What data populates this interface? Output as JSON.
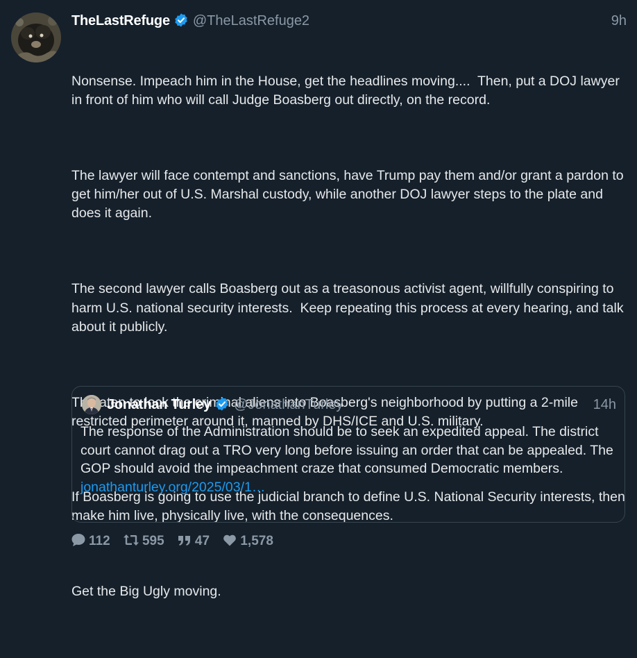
{
  "tweet": {
    "author": {
      "display_name": "TheLastRefuge",
      "handle": "@TheLastRefuge2",
      "verified_icon": "verified-badge-icon",
      "avatar_icon": "avatar-image"
    },
    "time": "9h",
    "paragraphs": [
      "Nonsense. Impeach him in the House, get the headlines moving....  Then, put a DOJ lawyer in front of him who will call Judge Boasberg out directly, on the record.",
      "The lawyer will face contempt and sanctions, have Trump pay them and/or grant a pardon to get him/her out of U.S. Marshal custody, while another DOJ lawyer steps to the plate and does it again.",
      "The second lawyer calls Boasberg out as a treasonous activist agent, willfully conspiring to harm U.S. national security interests.  Keep repeating this process at every hearing, and talk about it publicly.",
      "Threaten to lock the criminal aliens into Boasberg's neighborhood by putting a 2-mile restricted perimeter around it, manned by DHS/ICE and U.S. military.",
      "If Boasberg is going to use the judicial branch to define U.S. National Security interests, then make him live, physically live, with the consequences.",
      "Get the Big Ugly moving."
    ],
    "quote": {
      "display_name": "Jonathan Turley",
      "handle": "@JonathanTurley",
      "time": "14h",
      "text": "The response of the Administration should be to seek an expedited appeal. The district court cannot drag out a TRO very long before issuing an order that can be appealed. The GOP should avoid the impeachment craze that consumed Democratic members.",
      "link": "jonathanturley.org/2025/03/1…"
    },
    "stats": {
      "replies": "112",
      "retweets": "595",
      "quotes": "47",
      "likes": "1,578"
    }
  },
  "colors": {
    "background": "#15202b",
    "text": "#e7e9ea",
    "muted": "#8b98a5",
    "link": "#1d9bf0",
    "border": "#38444d",
    "verified": "#1d9bf0"
  }
}
